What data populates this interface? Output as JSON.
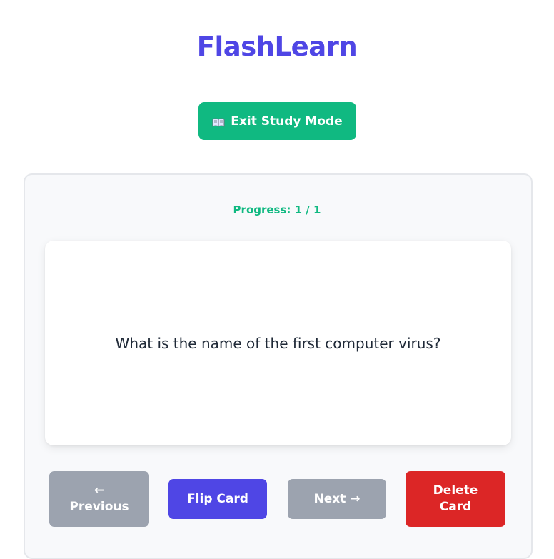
{
  "app": {
    "title": "FlashLearn"
  },
  "toolbar": {
    "exit_label": "Exit Study Mode",
    "exit_icon": "open-book-icon"
  },
  "study": {
    "progress_text": "Progress: 1 / 1",
    "progress_current": 1,
    "progress_total": 1,
    "card_text": "What is the name of the first computer virus?"
  },
  "controls": {
    "prev_arrow": "←",
    "prev_label": "Previous",
    "flip_label": "Flip Card",
    "next_label": "Next →",
    "delete_line1": "Delete",
    "delete_line2": "Card"
  },
  "colors": {
    "accent": "#4f46e5",
    "success": "#10b981",
    "danger": "#dc2626",
    "disabled": "#9ca3af"
  }
}
